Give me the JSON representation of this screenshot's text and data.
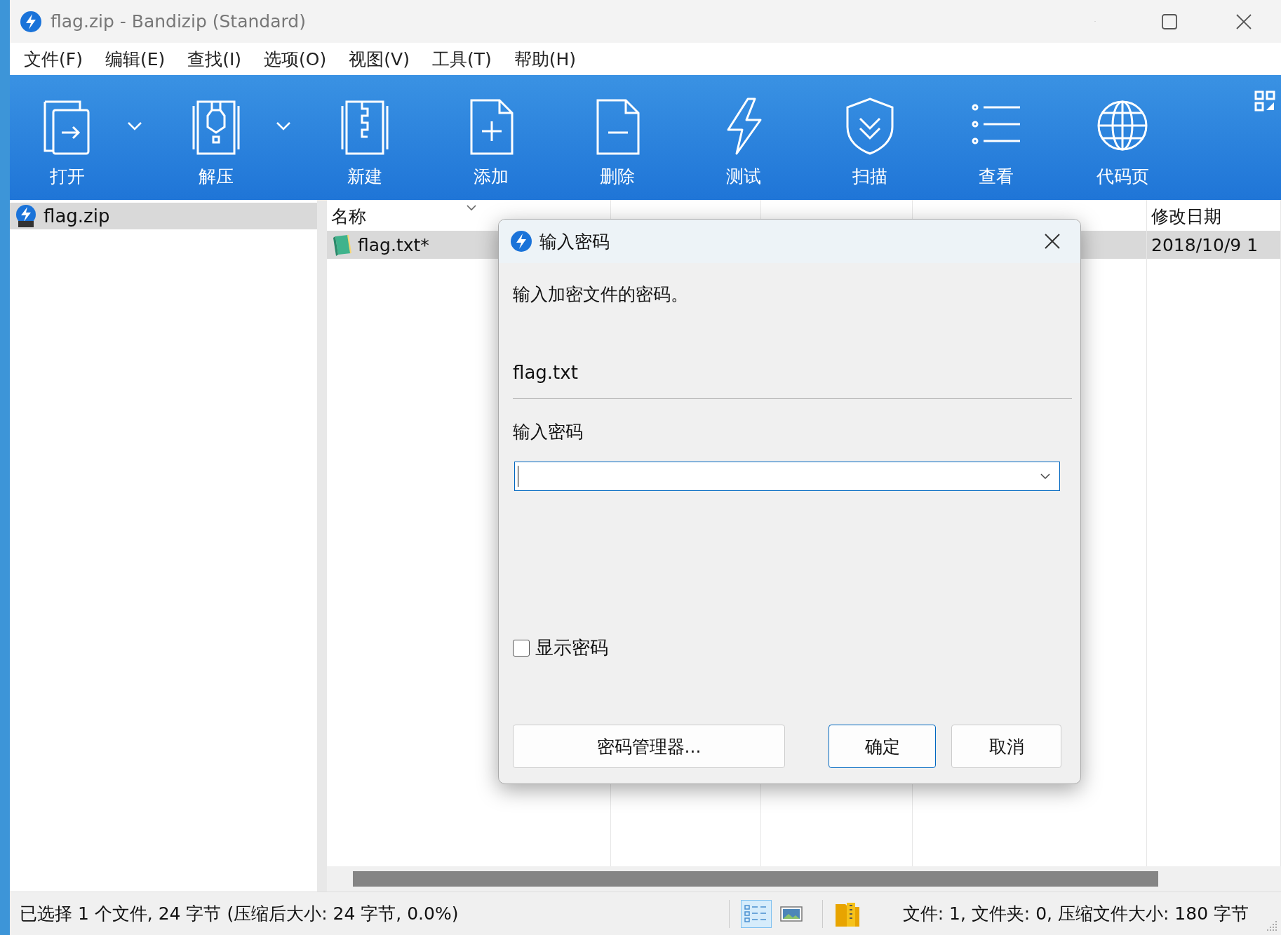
{
  "window": {
    "title": "flag.zip - Bandizip (Standard)"
  },
  "menu": [
    "文件(F)",
    "编辑(E)",
    "查找(I)",
    "选项(O)",
    "视图(V)",
    "工具(T)",
    "帮助(H)"
  ],
  "toolbar": [
    {
      "label": "打开",
      "kind": "open",
      "dropdown": true
    },
    {
      "label": "解压",
      "kind": "extract",
      "dropdown": true
    },
    {
      "label": "新建",
      "kind": "new",
      "dropdown": false
    },
    {
      "label": "添加",
      "kind": "add",
      "dropdown": false
    },
    {
      "label": "删除",
      "kind": "delete",
      "dropdown": false
    },
    {
      "label": "测试",
      "kind": "test",
      "dropdown": false
    },
    {
      "label": "扫描",
      "kind": "scan",
      "dropdown": false
    },
    {
      "label": "查看",
      "kind": "view",
      "dropdown": false
    },
    {
      "label": "代码页",
      "kind": "codepage",
      "dropdown": false
    }
  ],
  "tree": [
    {
      "label": "flag.zip",
      "selected": true
    }
  ],
  "table": {
    "columns": [
      "名称",
      "修改日期"
    ],
    "rows": [
      {
        "name": "flag.txt*",
        "modified": "2018/10/9 1",
        "selected": true
      }
    ]
  },
  "dialog": {
    "title": "输入密码",
    "message": "输入加密文件的密码。",
    "file_name": "flag.txt",
    "password_label": "输入密码",
    "show_password": {
      "label": "显示密码",
      "checked": false
    },
    "buttons": [
      {
        "label": "密码管理器...",
        "default": false
      },
      {
        "label": "确定",
        "default": true
      },
      {
        "label": "取消",
        "default": false
      }
    ]
  },
  "status_bar": {
    "selection": "已选择 1 个文件, 24 字节 (压缩后大小: 24 字节, 0.0%)",
    "view_modes": [
      {
        "kind": "details",
        "selected": true
      },
      {
        "kind": "preview",
        "selected": false
      }
    ],
    "summary": "文件: 1, 文件夹: 0, 压缩文件大小: 180 字节"
  }
}
